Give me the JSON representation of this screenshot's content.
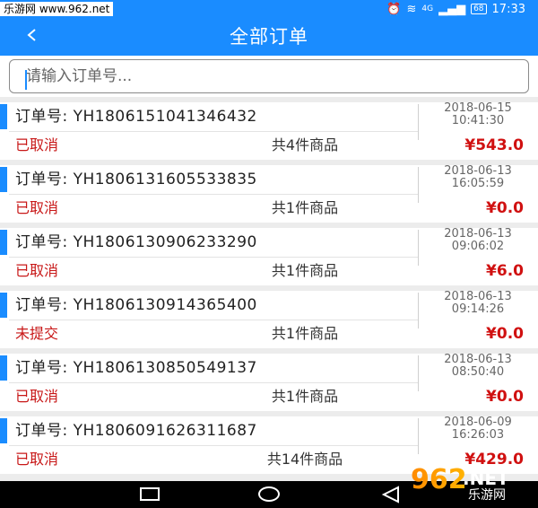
{
  "statusbar": {
    "watermark": "乐游网 www.962.net",
    "network": "4G",
    "battery": "68",
    "time": "17:33"
  },
  "header": {
    "back_icon": "chevron-left-icon",
    "title": "全部订单"
  },
  "search": {
    "placeholder": "请输入订单号..."
  },
  "orders": [
    {
      "order_no": "订单号: YH1806151041346432",
      "date": "2018-06-15",
      "time": "10:41:30",
      "status": "已取消",
      "count": "共4件商品",
      "amount": "¥543.0"
    },
    {
      "order_no": "订单号: YH1806131605533835",
      "date": "2018-06-13",
      "time": "16:05:59",
      "status": "已取消",
      "count": "共1件商品",
      "amount": "¥0.0"
    },
    {
      "order_no": "订单号: YH1806130906233290",
      "date": "2018-06-13",
      "time": "09:06:02",
      "status": "已取消",
      "count": "共1件商品",
      "amount": "¥6.0"
    },
    {
      "order_no": "订单号: YH1806130914365400",
      "date": "2018-06-13",
      "time": "09:14:26",
      "status": "未提交",
      "count": "共1件商品",
      "amount": "¥0.0"
    },
    {
      "order_no": "订单号: YH1806130850549137",
      "date": "2018-06-13",
      "time": "08:50:40",
      "status": "已取消",
      "count": "共1件商品",
      "amount": "¥0.0"
    },
    {
      "order_no": "订单号: YH1806091626311687",
      "date": "2018-06-09",
      "time": "16:26:03",
      "status": "已取消",
      "count": "共14件商品",
      "amount": "¥429.0"
    }
  ],
  "logo": {
    "line1": "962",
    "line2": ".NET",
    "line3": "乐游网"
  },
  "colors": {
    "primary": "#1a8cff",
    "status": "#c81818",
    "amount": "#d01010"
  }
}
